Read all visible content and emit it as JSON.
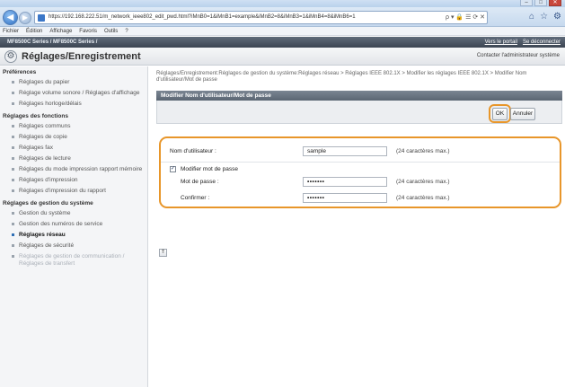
{
  "browser": {
    "url": "https://192.168.222.51/m_network_ieee802_edit_pwd.html?iMnB0=1&iMnB1=example&iMnB2=8&iMnB3=1&iMnB4=8&iMnB6=1",
    "address_tools": "ρ ▾ 🔒 ☰ ⟳ ✕",
    "window_controls": [
      "–",
      "□",
      "✕"
    ],
    "menu": [
      "Fichier",
      "Édition",
      "Affichage",
      "Favoris",
      "Outils",
      "?"
    ]
  },
  "app": {
    "model": "MF8500C Series / MF8500C Series /",
    "links": {
      "portal": "Vers le portail",
      "logout": "Se déconnecter"
    },
    "page_title": "Réglages/Enregistrement",
    "admin_link": "Contacter l'administrateur système"
  },
  "sidebar": {
    "sections": [
      {
        "title": "Préférences",
        "items": [
          {
            "label": "Réglages du papier"
          },
          {
            "label": "Réglage volume sonore / Réglages d'affichage"
          },
          {
            "label": "Réglages horloge/délais"
          }
        ]
      },
      {
        "title": "Réglages des fonctions",
        "items": [
          {
            "label": "Réglages communs"
          },
          {
            "label": "Réglages de copie"
          },
          {
            "label": "Réglages fax"
          },
          {
            "label": "Réglages de lecture"
          },
          {
            "label": "Réglages du mode impression rapport mémoire"
          },
          {
            "label": "Réglages d'impression"
          },
          {
            "label": "Réglages d'impression du rapport"
          }
        ]
      },
      {
        "title": "Réglages de gestion du système",
        "items": [
          {
            "label": "Gestion du système"
          },
          {
            "label": "Gestion des numéros de service"
          },
          {
            "label": "Réglages réseau"
          },
          {
            "label": "Réglages de sécurité"
          },
          {
            "label": "Réglages de gestion de communication / Réglages de transfert"
          }
        ]
      }
    ]
  },
  "main": {
    "breadcrumb": "Réglages/Enregistrement:Réglages de gestion du système:Réglages réseau > Réglages IEEE 802.1X > Modifier les réglages IEEE 802.1X > Modifier Nom d'utilisateur/Mot de passe",
    "panel_title": "Modifier Nom d'utilisateur/Mot de passe",
    "ok_label": "OK",
    "cancel_label": "Annuler",
    "username_label": "Nom d'utilisateur :",
    "username_value": "sample",
    "username_hint": "(24 caractères max.)",
    "change_pw_label": "Modifier mot de passe",
    "change_pw_checked": true,
    "password_label": "Mot de passe :",
    "password_value": "•••••••",
    "password_hint": "(24 caractères max.)",
    "confirm_label": "Confirmer :",
    "confirm_value": "•••••••",
    "confirm_hint": "(24 caractères max.)",
    "top_icon": "⇑"
  },
  "colors": {
    "highlight": "#e8962a",
    "header_dark": "#3b4552",
    "panel_head": "#5b6673"
  }
}
